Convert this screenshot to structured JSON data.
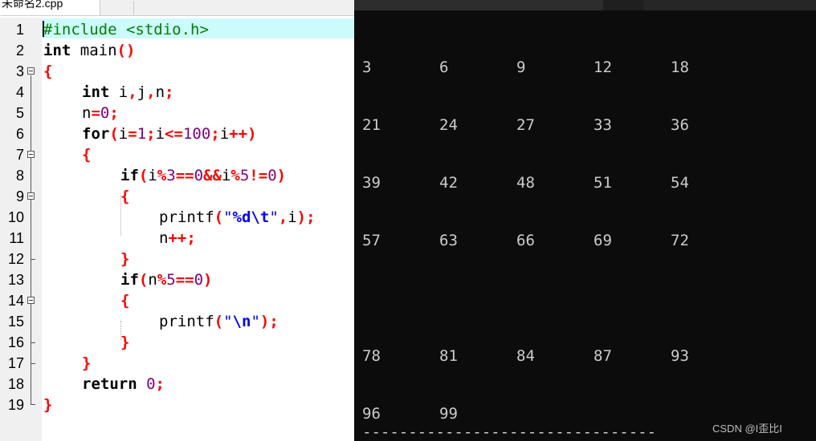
{
  "editor": {
    "file_tab": "未命名2.cpp",
    "line_numbers": [
      "1",
      "2",
      "3",
      "4",
      "5",
      "6",
      "7",
      "8",
      "9",
      "10",
      "11",
      "12",
      "13",
      "14",
      "15",
      "16",
      "17",
      "18",
      "19"
    ]
  },
  "code": {
    "l1": {
      "a": "#include <stdio.h>"
    },
    "l2": {
      "a": "int",
      "b": " main",
      "c": "()"
    },
    "l3": {
      "a": "{"
    },
    "l4": {
      "a": "int",
      "b": " i",
      "c": ",",
      "d": "j",
      "e": ",",
      "f": "n",
      "g": ";"
    },
    "l5": {
      "a": "n",
      "b": "=",
      "c": "0",
      "d": ";"
    },
    "l6": {
      "a": "for",
      "b": "(",
      "c": "i",
      "d": "=",
      "e": "1",
      "f": ";",
      "g": "i",
      "h": "<=",
      "i": "100",
      "j": ";",
      "k": "i",
      "l": "++",
      "m": ")"
    },
    "l7": {
      "a": "{"
    },
    "l8": {
      "a": "if",
      "b": "(",
      "c": "i",
      "d": "%",
      "e": "3",
      "f": "==",
      "g": "0",
      "h": "&&",
      "i": "i",
      "j": "%",
      "k": "5",
      "l": "!=",
      "m": "0",
      "n": ")"
    },
    "l9": {
      "a": "{"
    },
    "l10": {
      "a": "printf",
      "b": "(",
      "c": "\"",
      "d": "%d\\t",
      "e": "\"",
      "f": ",",
      "g": "i",
      "h": ");"
    },
    "l11": {
      "a": "n",
      "b": "++;"
    },
    "l12": {
      "a": "}"
    },
    "l13": {
      "a": "if",
      "b": "(",
      "c": "n",
      "d": "%",
      "e": "5",
      "f": "==",
      "g": "0",
      "h": ")"
    },
    "l14": {
      "a": "{"
    },
    "l15": {
      "a": "printf",
      "b": "(",
      "c": "\"",
      "d": "\\n",
      "e": "\"",
      "f": ");"
    },
    "l16": {
      "a": "}"
    },
    "l17": {
      "a": "}"
    },
    "l18": {
      "a": "return",
      "b": " ",
      "c": "0",
      "d": ";"
    },
    "l19": {
      "a": "}"
    }
  },
  "console": {
    "rows": [
      [
        "3",
        "6",
        "9",
        "12",
        "18"
      ],
      [
        "21",
        "24",
        "27",
        "33",
        "36"
      ],
      [
        "39",
        "42",
        "48",
        "51",
        "54"
      ],
      [
        "57",
        "63",
        "66",
        "69",
        "72"
      ],
      [
        "78",
        "81",
        "84",
        "87",
        "93"
      ],
      [
        "96",
        "99"
      ]
    ],
    "separator": "--------------------------------",
    "watermark": "CSDN @I歪比I"
  },
  "colors": {
    "keyword": "#000000",
    "preprocessor": "#008000",
    "operator": "#ff0000",
    "number": "#800080",
    "string": "#0000ff",
    "current_line": "#ccfbfb",
    "console_bg": "#0c0c0c",
    "console_fg": "#cccccc"
  }
}
